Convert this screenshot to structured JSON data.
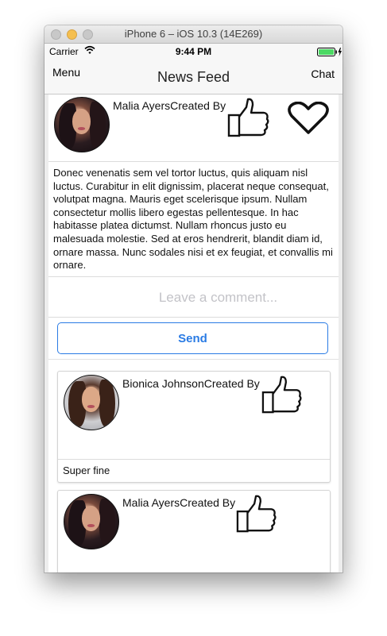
{
  "window": {
    "title": "iPhone 6 – iOS 10.3 (14E269)"
  },
  "status_bar": {
    "carrier": "Carrier",
    "time": "9:44 PM",
    "battery_color": "#4cd964"
  },
  "nav": {
    "left": "Menu",
    "title": "News Feed",
    "right": "Chat"
  },
  "post": {
    "author": "Malia Ayers",
    "created_label": "Created By",
    "body": "Donec venenatis sem vel tortor luctus, quis aliquam nisl luctus. Curabitur in elit dignissim, placerat neque consequat, volutpat magna. Mauris eget scelerisque ipsum. Nullam consectetur mollis libero egestas pellentesque. In hac habitasse platea dictumst. Nullam rhoncus justo eu malesuada molestie. Sed at eros hendrerit, blandit diam id, ornare massa. Nunc sodales nisi et ex feugiat, et convallis mi ornare.",
    "comment_placeholder": "Leave a comment...",
    "send_label": "Send"
  },
  "comments": [
    {
      "author": "Bionica Johnson",
      "created_label": "Created By",
      "text": "Super fine"
    },
    {
      "author": "Malia Ayers",
      "created_label": "Created By",
      "text": ""
    }
  ],
  "colors": {
    "accent": "#2a7be4",
    "placeholder": "#c3c3c8"
  },
  "icons": [
    "thumbs-up-icon",
    "heart-icon",
    "wifi-icon",
    "battery-icon",
    "charging-icon"
  ]
}
